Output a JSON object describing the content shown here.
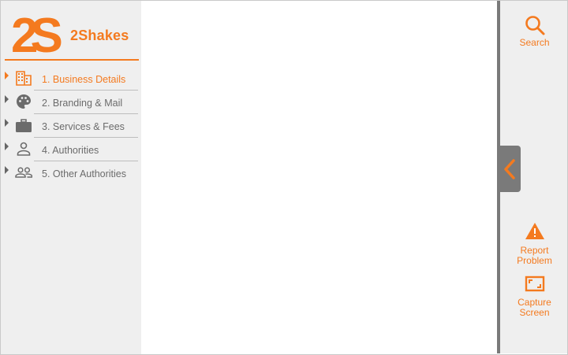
{
  "brand": {
    "name": "2Shakes",
    "mark_text": "2S",
    "accent": "#f47a1f"
  },
  "sidebar": {
    "items": [
      {
        "label": "1. Business Details",
        "icon": "building-icon",
        "active": true
      },
      {
        "label": "2. Branding & Mail",
        "icon": "palette-icon",
        "active": false
      },
      {
        "label": "3. Services & Fees",
        "icon": "briefcase-icon",
        "active": false
      },
      {
        "label": "4. Authorities",
        "icon": "person-icon",
        "active": false
      },
      {
        "label": "5. Other Authorities",
        "icon": "people-icon",
        "active": false
      }
    ]
  },
  "right_panel": {
    "search_label": "Search",
    "report_label_line1": "Report",
    "report_label_line2": "Problem",
    "capture_label_line1": "Capture",
    "capture_label_line2": "Screen"
  },
  "colors": {
    "sidebar_bg": "#efefef",
    "rail": "#7a7a7a",
    "text_muted": "#6b6b6b"
  }
}
